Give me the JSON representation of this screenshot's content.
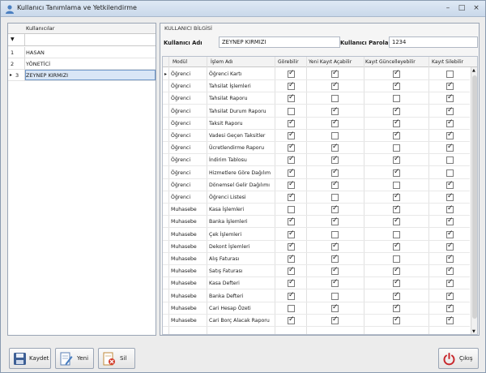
{
  "window": {
    "title": "Kullanıcı Tanımlama ve Yetkilendirme",
    "minimize": "–",
    "maximize": "□",
    "close": "×"
  },
  "users": {
    "header": "Kullanıcılar",
    "rows": [
      {
        "no": "1",
        "name": "HASAN"
      },
      {
        "no": "2",
        "name": "YÖNETİCİ"
      },
      {
        "no": "3",
        "name": "ZEYNEP KIRMIZI"
      }
    ],
    "selected_index": 2
  },
  "panel": {
    "title": "KULLANICI BİLGİSİ",
    "username_label": "Kullanıcı Adı",
    "username_value": "ZEYNEP KIRMIZI",
    "password_label": "Kullanıcı Parolası",
    "password_value": "1234"
  },
  "grid": {
    "columns": [
      "Modül",
      "İşlem Adı",
      "Görebilir",
      "Yeni Kayıt Açabilir",
      "Kayıt Güncelleyebilir",
      "Kayıt Silebilir"
    ],
    "rows": [
      {
        "mod": "Öğrenci",
        "name": "Öğrenci Kartı",
        "v": [
          1,
          1,
          1,
          0
        ]
      },
      {
        "mod": "Öğrenci",
        "name": "Tahsilat İşlemleri",
        "v": [
          1,
          1,
          1,
          1
        ]
      },
      {
        "mod": "Öğrenci",
        "name": "Tahsilat Raporu",
        "v": [
          1,
          0,
          0,
          1
        ]
      },
      {
        "mod": "Öğrenci",
        "name": "Tahsilat Durum Raporu",
        "v": [
          0,
          1,
          1,
          1
        ]
      },
      {
        "mod": "Öğrenci",
        "name": "Taksit Raporu",
        "v": [
          1,
          1,
          1,
          1
        ]
      },
      {
        "mod": "Öğrenci",
        "name": "Vadesi Geçen Taksitler",
        "v": [
          1,
          0,
          1,
          1
        ]
      },
      {
        "mod": "Öğrenci",
        "name": "Ücretlendirme Raporu",
        "v": [
          1,
          1,
          0,
          1
        ]
      },
      {
        "mod": "Öğrenci",
        "name": "İndirim Tablosu",
        "v": [
          1,
          1,
          1,
          0
        ]
      },
      {
        "mod": "Öğrenci",
        "name": "Hizmetlere Göre Dağılım",
        "v": [
          1,
          1,
          1,
          0
        ]
      },
      {
        "mod": "Öğrenci",
        "name": "Dönemsel Gelir Dağılımı",
        "v": [
          1,
          1,
          0,
          1
        ]
      },
      {
        "mod": "Öğrenci",
        "name": "Öğrenci Listesi",
        "v": [
          1,
          0,
          1,
          1
        ]
      },
      {
        "mod": "Muhasebe",
        "name": "Kasa İşlemleri",
        "v": [
          0,
          1,
          1,
          1
        ]
      },
      {
        "mod": "Muhasebe",
        "name": "Banka İşlemleri",
        "v": [
          1,
          1,
          1,
          1
        ]
      },
      {
        "mod": "Muhasebe",
        "name": "Çek İşlemleri",
        "v": [
          1,
          0,
          0,
          1
        ]
      },
      {
        "mod": "Muhasebe",
        "name": "Dekont İşlemleri",
        "v": [
          1,
          1,
          1,
          1
        ]
      },
      {
        "mod": "Muhasebe",
        "name": "Alış Faturası",
        "v": [
          1,
          1,
          0,
          1
        ]
      },
      {
        "mod": "Muhasebe",
        "name": "Satış Faturası",
        "v": [
          1,
          1,
          1,
          1
        ]
      },
      {
        "mod": "Muhasebe",
        "name": "Kasa Defteri",
        "v": [
          1,
          1,
          1,
          1
        ]
      },
      {
        "mod": "Muhasebe",
        "name": "Banka Defteri",
        "v": [
          1,
          0,
          1,
          1
        ]
      },
      {
        "mod": "Muhasebe",
        "name": "Cari Hesap Özeti",
        "v": [
          0,
          1,
          1,
          1
        ]
      },
      {
        "mod": "Muhasebe",
        "name": "Cari Borç Alacak Raporu",
        "v": [
          1,
          1,
          1,
          1
        ]
      }
    ]
  },
  "buttons": {
    "save": "Kaydet",
    "new": "Yeni",
    "delete": "Sil",
    "exit": "Çıkış"
  },
  "icons": [
    "app-icon",
    "floppy-disk-icon",
    "edit-document-icon",
    "delete-document-icon",
    "power-icon"
  ],
  "colors": {
    "selection": "#d9e6f6",
    "selection_border": "#6f97c9",
    "power_icon": "#c8282d"
  }
}
